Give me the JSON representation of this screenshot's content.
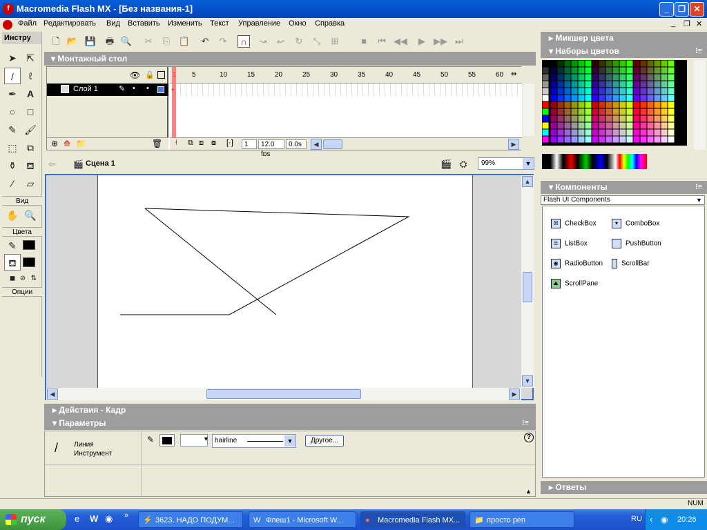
{
  "window": {
    "title": "Macromedia Flash MX - [Без названия-1]"
  },
  "menu": [
    "Файл",
    "Редактировать",
    "Вид",
    "Вставить",
    "Изменить",
    "Текст",
    "Управление",
    "Окно",
    "Справка"
  ],
  "tools": {
    "header": "Инстру",
    "view_label": "Вид",
    "colors_label": "Цвета",
    "options_label": "Опции"
  },
  "timeline": {
    "header": "Монтажный стол",
    "layer_name": "Слой 1",
    "ruler": [
      "1",
      "5",
      "10",
      "15",
      "20",
      "25",
      "30",
      "35",
      "40",
      "45",
      "50",
      "55",
      "60"
    ],
    "current_frame": "1",
    "fps": "12.0 fps",
    "time": "0.0s"
  },
  "scene": {
    "label": "Сцена 1",
    "zoom": "99%"
  },
  "panels": {
    "actions": "Действия - Кадр",
    "params": "Параметры",
    "color_mixer": "Микшер цвета",
    "swatches": "Наборы цветов",
    "components": "Компоненты",
    "answers": "Ответы"
  },
  "properties": {
    "tool_name_1": "Линия",
    "tool_name_2": "Инструмент",
    "stroke_style": "hairline",
    "other_button": "Другое..."
  },
  "components": {
    "set": "Flash UI Components",
    "items": [
      "CheckBox",
      "ComboBox",
      "ListBox",
      "PushButton",
      "RadioButton",
      "ScrollBar",
      "ScrollPane"
    ]
  },
  "status": {
    "mode": "NUM"
  },
  "taskbar": {
    "start": "пуск",
    "tasks": [
      "3623. НАДО ПОДУМ...",
      "Флеш1 - Microsoft W...",
      "Macromedia Flash MX...",
      "просто реп"
    ],
    "lang": "RU",
    "clock": "20:26"
  },
  "colors": {
    "accent": "#3a6ec8",
    "playhead": "#ff6666",
    "titlebar": "#0454cf"
  }
}
